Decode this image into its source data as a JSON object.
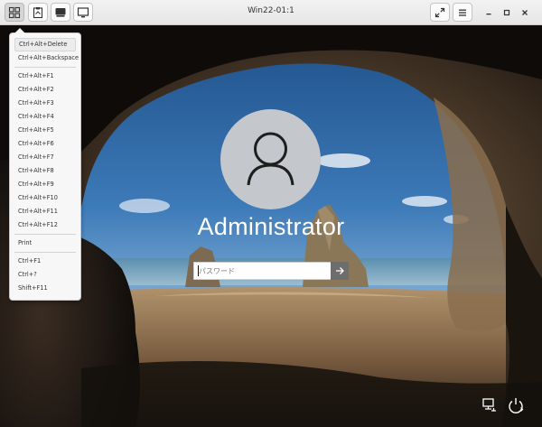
{
  "window": {
    "title": "Win22-01:1"
  },
  "toolbar": {
    "left_buttons": [
      {
        "name": "send-keys-button",
        "icon": "keys-menu-icon"
      },
      {
        "name": "clipboard-button",
        "icon": "clipboard-icon"
      },
      {
        "name": "usb-redirect-button",
        "icon": "usb-drive-icon"
      },
      {
        "name": "display-button",
        "icon": "monitor-icon"
      }
    ],
    "right_buttons": [
      {
        "name": "fullscreen-button",
        "icon": "expand-icon"
      },
      {
        "name": "hamburger-menu-button",
        "icon": "hamburger-icon"
      },
      {
        "name": "minimize-button",
        "icon": "minimize-icon"
      },
      {
        "name": "maximize-button",
        "icon": "maximize-icon"
      },
      {
        "name": "close-button",
        "icon": "close-icon"
      }
    ]
  },
  "keys_menu": {
    "groups": [
      [
        "Ctrl+Alt+Delete",
        "Ctrl+Alt+Backspace"
      ],
      [
        "Ctrl+Alt+F1",
        "Ctrl+Alt+F2",
        "Ctrl+Alt+F3",
        "Ctrl+Alt+F4",
        "Ctrl+Alt+F5",
        "Ctrl+Alt+F6",
        "Ctrl+Alt+F7",
        "Ctrl+Alt+F8",
        "Ctrl+Alt+F9",
        "Ctrl+Alt+F10",
        "Ctrl+Alt+F11",
        "Ctrl+Alt+F12"
      ],
      [
        "Print"
      ],
      [
        "Ctrl+F1",
        "Ctrl+?",
        "Shift+F11"
      ]
    ]
  },
  "login": {
    "username": "Administrator",
    "password_placeholder": "パスワード",
    "submit_icon": "arrow-right-icon",
    "bottom_icons": [
      "network-icon",
      "power-icon"
    ]
  },
  "colors": {
    "titlebar": "#ececec",
    "menu_bg": "#f7f7f7",
    "avatar_bg": "#c4c7cb",
    "submit_bg": "#6d6d6d"
  }
}
